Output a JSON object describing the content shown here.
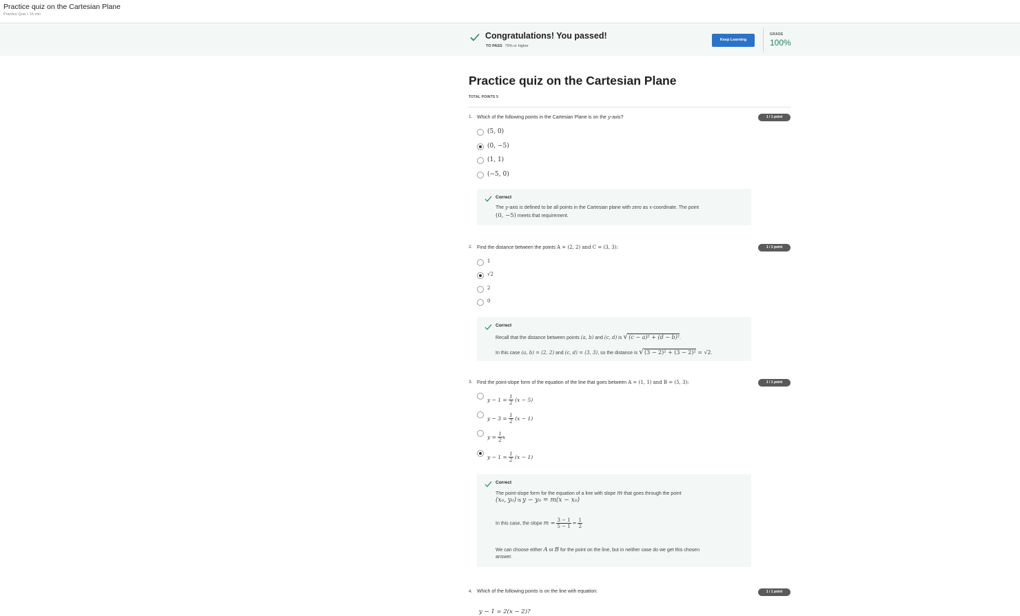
{
  "topbar": {
    "title": "Practice quiz on the Cartesian Plane",
    "subtitle": "Practice Quiz • 15 min"
  },
  "banner": {
    "message": "Congratulations! You passed!",
    "to_pass_label": "TO PASS",
    "to_pass_value": "75% or higher",
    "button": "Keep Learning",
    "grade_label": "GRADE",
    "grade_value": "100%"
  },
  "quiz": {
    "title": "Practice quiz on the Cartesian Plane",
    "total_points": "TOTAL POINTS 5"
  },
  "questions": [
    {
      "num": "1.",
      "text_pre": "Which of the following points in the Cartesian Plane is on the ",
      "var": "y",
      "text_post": "-axis?",
      "badge": "1 / 1 point",
      "options": [
        "(5, 0)",
        "(0, −5)",
        "(1, 1)",
        "(−5, 0)"
      ],
      "selected": 1,
      "feedback": {
        "heading": "Correct",
        "line1_pre": "The ",
        "line1_var1": "y",
        "line1_mid": "-axis is defined to be all points in the Cartesian plane with zero as ",
        "line1_var2": "x",
        "line1_post": "-coordinate. The point",
        "line2_math": "(0, −5)",
        "line2_post": " meets that requirement."
      }
    },
    {
      "num": "2.",
      "text_pre": "Find the distance between the points ",
      "text_math": "A = (2, 2) and C = (3, 3):",
      "badge": "1 / 1 point",
      "options": [
        "1",
        "√2",
        "2",
        "0"
      ],
      "selected": 1,
      "feedback": {
        "heading": "Correct",
        "line1_pre": "Recall that the distance between points ",
        "line1_m1": "(a, b)",
        "line1_mid": " and ",
        "line1_m2": "(c, d)",
        "line1_is": " is ",
        "line1_root": "(c − a)² + (d − b)²",
        "line1_end": ".",
        "line2_pre": "In this case ",
        "line2_m1": "(a, b) = (2, 2)",
        "line2_mid": " and ",
        "line2_m2": "(c, d) = (3, 3)",
        "line2_so": ", so the distance is ",
        "line2_root": "(3 − 2)² + (3 − 2)²",
        "line2_eq": " = √2",
        "line2_end": "."
      }
    },
    {
      "num": "3.",
      "text_pre": "Find the point-slope form of the equation of the line that goes between ",
      "text_math": "A = (1, 1) and B = (5, 3):",
      "badge": "1 / 1 point",
      "options": [
        {
          "lhs": "y − 1 =",
          "num": "1",
          "den": "2",
          "rhs": "(x − 5)"
        },
        {
          "lhs": "y − 3 =",
          "num": "1",
          "den": "2",
          "rhs": "(x − 1)"
        },
        {
          "lhs": "y =",
          "num": "1",
          "den": "2",
          "rhs": "x"
        },
        {
          "lhs": "y − 1 =",
          "num": "1",
          "den": "2",
          "rhs": "(x − 1)"
        }
      ],
      "selected": 3,
      "feedback": {
        "heading": "Correct",
        "line1_pre": "The point-slope form for the equation of a line with slope ",
        "line1_var": "m",
        "line1_post": " that goes through the point",
        "line2_m1": "(x₀, y₀)",
        "line2_is": " is ",
        "line2_m2": "y − y₀ = m(x − x₀)",
        "line3_pre": "In this case, the slope ",
        "line3_var": "m =",
        "line3_num1": "3 − 1",
        "line3_den1": "5 − 1",
        "line3_eq": "=",
        "line3_num2": "1",
        "line3_den2": "2",
        "line4_pre": "We can choose either ",
        "line4_a": "A",
        "line4_or": " or ",
        "line4_b": "B",
        "line4_post": " for the point on the line, but in neither case do we get this chosen",
        "line5": "answer."
      }
    },
    {
      "num": "4.",
      "text_pre": "Which of the following points is on the line with equation:",
      "badge": "1 / 1 point",
      "equation": "y − 1 = 2(x − 2)?"
    }
  ]
}
